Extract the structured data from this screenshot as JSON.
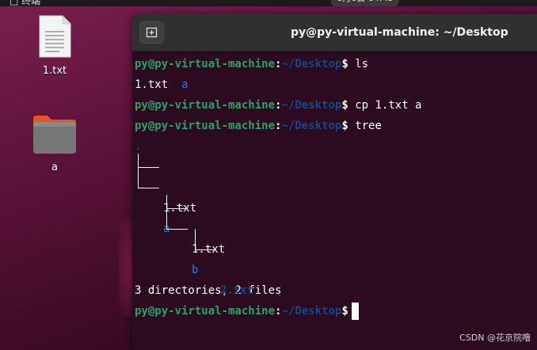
{
  "top_panel": {
    "left_label": "□ 终端",
    "clock": "8月6日 04:45"
  },
  "desktop": {
    "icons": [
      {
        "label": "1.txt",
        "type": "file"
      },
      {
        "label": "a",
        "type": "folder"
      }
    ]
  },
  "terminal": {
    "title": "py@py-virtual-machine: ~/Desktop",
    "prompt_user": "py@py-virtual-machine",
    "prompt_sep": ":",
    "prompt_path": "~/Desktop",
    "prompt_sigil": "$",
    "commands": [
      "ls",
      "cp 1.txt a",
      "tree"
    ],
    "ls_output": {
      "file": "1.txt",
      "dir": "a"
    },
    "tree": {
      "root": ".",
      "entries": [
        {
          "name": "1.txt",
          "kind": "file",
          "depth": 1
        },
        {
          "name": "a",
          "kind": "dir",
          "depth": 1
        },
        {
          "name": "1.txt",
          "kind": "file",
          "depth": 2
        },
        {
          "name": "b",
          "kind": "dir",
          "depth": 2
        },
        {
          "name": "2.txt",
          "kind": "file-highlight",
          "depth": 3
        }
      ],
      "summary": "3 directories, 2 files"
    }
  },
  "colors": {
    "prompt_user": "#26a269",
    "prompt_path": "#12488b",
    "directory": "#2a7bde",
    "terminal_bg": "#2c0a1f"
  },
  "watermark": "CSDN @花京院噜"
}
